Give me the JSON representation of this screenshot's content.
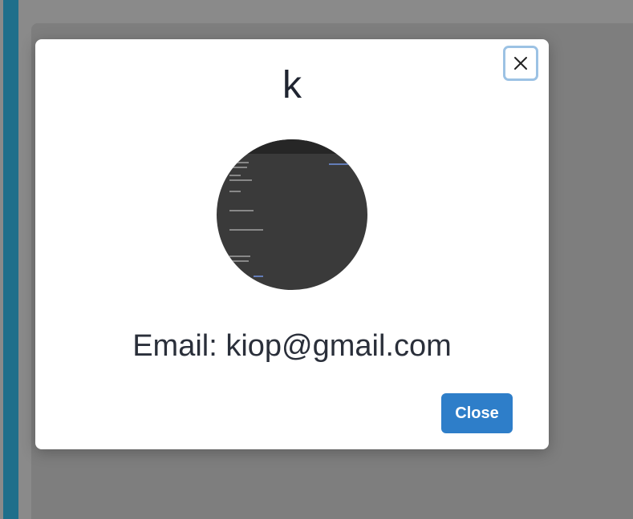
{
  "modal": {
    "title": "k",
    "email_text": "Email: kiop@gmail.com",
    "close_button_label": "Close",
    "close_icon": "close-icon",
    "avatar_icon": "avatar-image"
  },
  "colors": {
    "accent": "#2e7ec9",
    "sidebar_accent": "#1f6f8b",
    "overlay": "#8a8a8a"
  }
}
